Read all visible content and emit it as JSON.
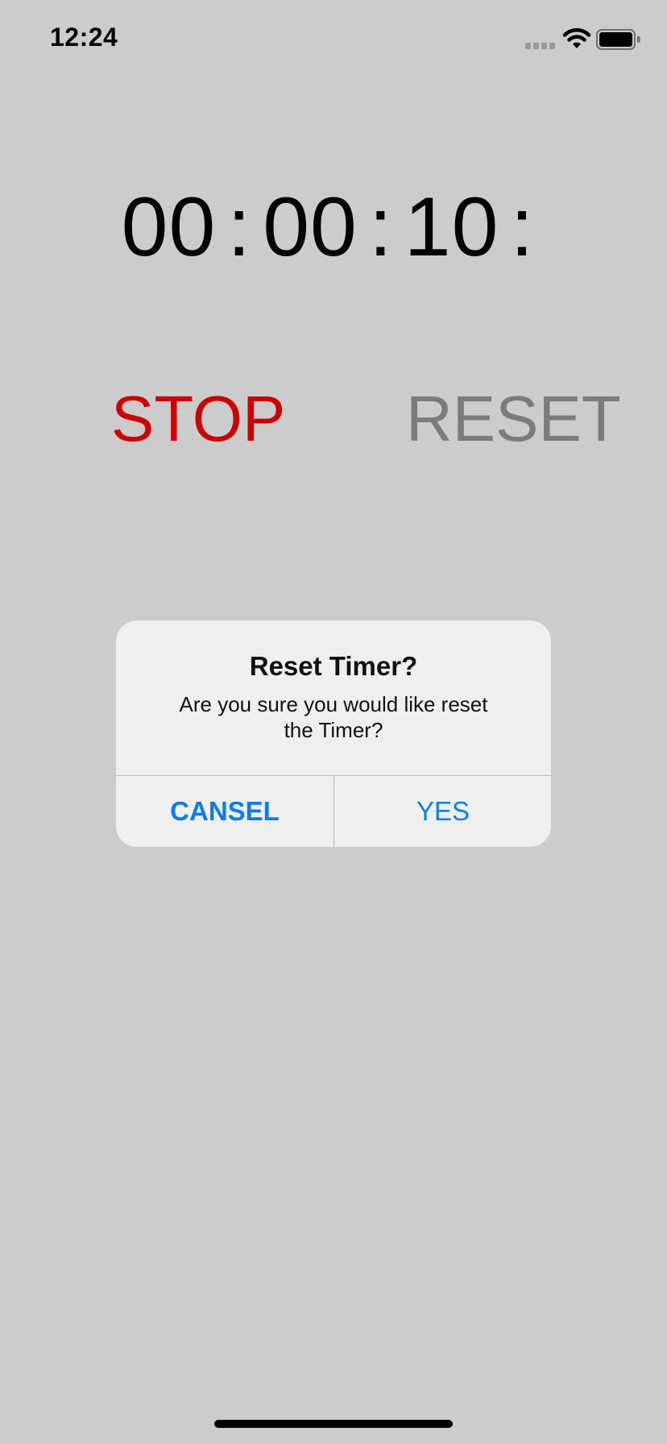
{
  "status_bar": {
    "time": "12:24",
    "icons": [
      "signal-icon",
      "wifi-icon",
      "battery-icon"
    ]
  },
  "timer": {
    "hours": "00",
    "minutes": "00",
    "seconds": "10",
    "separator": ":"
  },
  "controls": {
    "stop_label": "STOP",
    "reset_label": "RESET"
  },
  "alert": {
    "title": "Reset Timer?",
    "message": "Are you sure you would like reset the Timer?",
    "cancel_label": "CANSEL",
    "yes_label": "YES"
  },
  "colors": {
    "background": "#cccccc",
    "stop": "#cc0000",
    "reset": "#7b7b7b",
    "alert_button": "#0a7cf0",
    "alert_background": "#f0efef"
  }
}
